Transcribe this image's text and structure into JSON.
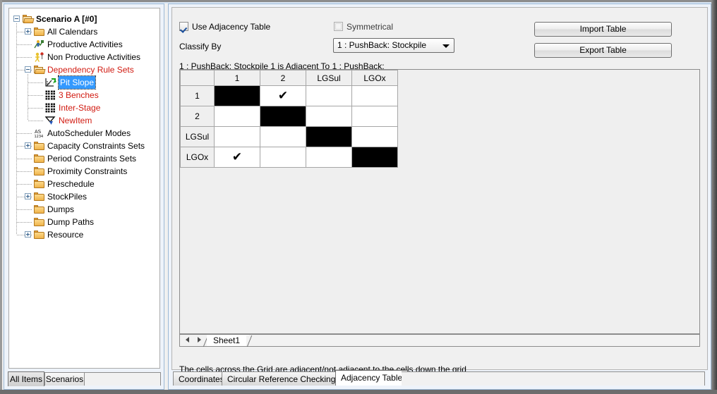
{
  "tree": {
    "items": [
      {
        "label": "Scenario A [#0]",
        "depth": 0,
        "icon": "folder-open-icon",
        "toggle": "minus",
        "style": "bold"
      },
      {
        "label": "All Calendars",
        "depth": 1,
        "icon": "folder-closed-icon",
        "toggle": "plus",
        "style": "normal"
      },
      {
        "label": "Productive Activities",
        "depth": 1,
        "icon": "productive-activity-icon",
        "toggle": "none",
        "style": "normal"
      },
      {
        "label": "Non Productive Activities",
        "depth": 1,
        "icon": "non-productive-activity-icon",
        "toggle": "none",
        "style": "normal"
      },
      {
        "label": "Dependency Rule Sets",
        "depth": 1,
        "icon": "folder-open-icon",
        "toggle": "minus",
        "style": "red"
      },
      {
        "label": "Pit Slope",
        "depth": 2,
        "icon": "pit-slope-icon",
        "toggle": "none",
        "style": "selected"
      },
      {
        "label": "3 Benches",
        "depth": 2,
        "icon": "benches-icon",
        "toggle": "none",
        "style": "red"
      },
      {
        "label": "Inter-Stage",
        "depth": 2,
        "icon": "inter-stage-icon",
        "toggle": "none",
        "style": "red"
      },
      {
        "label": "NewItem",
        "depth": 2,
        "icon": "new-item-icon",
        "toggle": "none",
        "style": "red"
      },
      {
        "label": "AutoScheduler Modes",
        "depth": 1,
        "icon": "autoscheduler-icon",
        "toggle": "none",
        "style": "normal"
      },
      {
        "label": "Capacity Constraints Sets",
        "depth": 1,
        "icon": "folder-closed-icon",
        "toggle": "plus",
        "style": "normal"
      },
      {
        "label": "Period Constraints Sets",
        "depth": 1,
        "icon": "folder-closed-icon",
        "toggle": "none",
        "style": "normal"
      },
      {
        "label": "Proximity Constraints",
        "depth": 1,
        "icon": "folder-closed-icon",
        "toggle": "none",
        "style": "normal"
      },
      {
        "label": "Preschedule",
        "depth": 1,
        "icon": "folder-closed-icon",
        "toggle": "none",
        "style": "normal"
      },
      {
        "label": "StockPiles",
        "depth": 1,
        "icon": "folder-closed-icon",
        "toggle": "plus",
        "style": "normal"
      },
      {
        "label": "Dumps",
        "depth": 1,
        "icon": "folder-closed-icon",
        "toggle": "none",
        "style": "normal"
      },
      {
        "label": "Dump Paths",
        "depth": 1,
        "icon": "folder-closed-icon",
        "toggle": "none",
        "style": "normal"
      },
      {
        "label": "Resource",
        "depth": 1,
        "icon": "folder-closed-icon",
        "toggle": "plus",
        "style": "normal"
      }
    ],
    "bottom_tabs": [
      {
        "label": "All Items",
        "active": true
      },
      {
        "label": "Scenarios",
        "active": false
      }
    ]
  },
  "panel": {
    "use_adjacency_table_label": "Use Adjacency Table",
    "use_adjacency_table_checked": true,
    "symmetrical_label": "Symmetrical",
    "symmetrical_checked": false,
    "classify_by_label": "Classify By",
    "classify_by_value": "1 : PushBack: Stockpile",
    "import_button": "Import Table",
    "export_button": "Export Table",
    "grid_caption": "1 : PushBack: Stockpile 1 is Adjacent To 1 : PushBack:",
    "sheet_tab": "Sheet1",
    "status_text": "The cells across the Grid are adjacent/not adjacent to the cells down the grid",
    "bottom_tabs": [
      {
        "label": "Coordinates",
        "active": false
      },
      {
        "label": "Circular Reference Checking",
        "active": false
      },
      {
        "label": "Adjacency Table",
        "active": true
      }
    ]
  },
  "adjacency_grid": {
    "corner": "",
    "columns": [
      "1",
      "2",
      "LGSul",
      "LGOx"
    ],
    "rows": [
      "1",
      "2",
      "LGSul",
      "LGOx"
    ],
    "check_mark": "✔",
    "cells": [
      [
        "black",
        "check",
        "",
        ""
      ],
      [
        "",
        "black",
        "",
        ""
      ],
      [
        "",
        "",
        "black",
        ""
      ],
      [
        "check",
        "",
        "",
        "black"
      ]
    ]
  }
}
